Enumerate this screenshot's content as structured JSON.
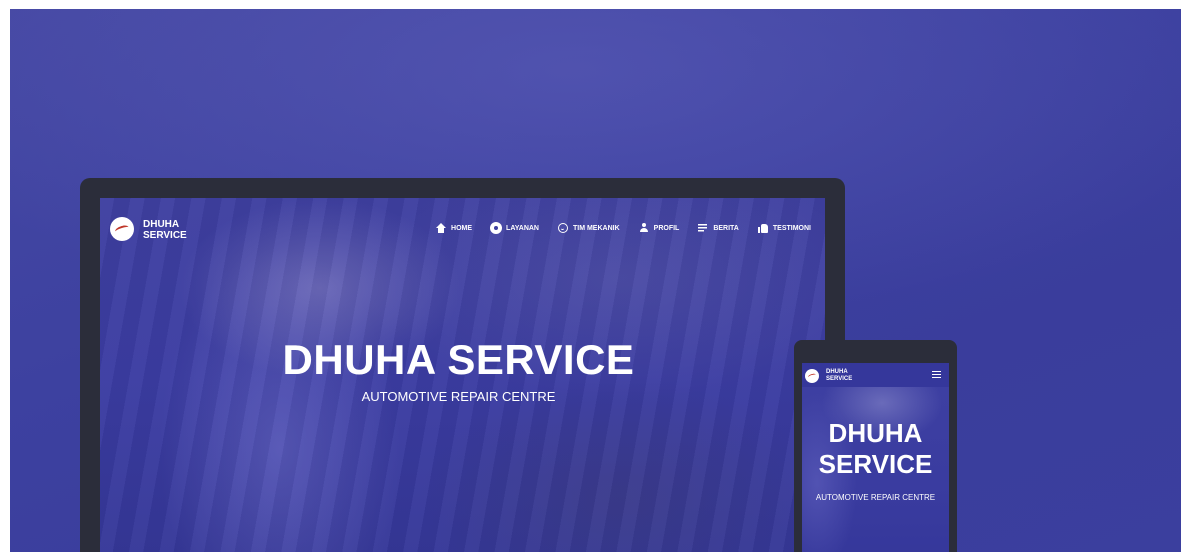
{
  "site": {
    "brand_line1": "DHUHA",
    "brand_line2": "SERVICE"
  },
  "nav": {
    "items": [
      {
        "label": "HOME",
        "icon": "home-icon"
      },
      {
        "label": "LAYANAN",
        "icon": "gear-icon"
      },
      {
        "label": "TIM MEKANIK",
        "icon": "smile-icon"
      },
      {
        "label": "PROFIL",
        "icon": "person-icon"
      },
      {
        "label": "BERITA",
        "icon": "article-icon"
      },
      {
        "label": "TESTIMONI",
        "icon": "thumbs-up-icon"
      }
    ]
  },
  "hero": {
    "title": "DHUHA SERVICE",
    "title_mobile_line1": "DHUHA",
    "title_mobile_line2": "SERVICE",
    "subtitle": "AUTOMOTIVE REPAIR CENTRE"
  },
  "colors": {
    "background": "#3d41a0",
    "device_frame": "#2b2d3a",
    "overlay": "#3b3ca2"
  }
}
